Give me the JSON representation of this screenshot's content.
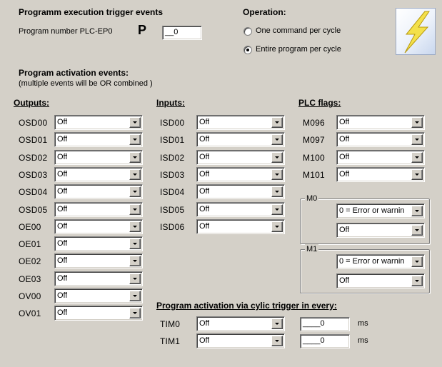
{
  "header": {
    "title": "Programm execution trigger events",
    "program_number_label": "Program number PLC-EP0",
    "p_label": "P",
    "program_number_value": "__0"
  },
  "operation": {
    "title": "Operation:",
    "options": [
      {
        "label": "One command per cycle",
        "selected": false
      },
      {
        "label": "Entire program per cycle",
        "selected": true
      }
    ]
  },
  "logo_icon": "lightning-bolt-icon",
  "activation": {
    "title": "Program activation events:",
    "note": "(multiple events will be OR combined )"
  },
  "outputs": {
    "header": "Outputs:",
    "rows": [
      {
        "label": "OSD00",
        "value": "Off"
      },
      {
        "label": "OSD01",
        "value": "Off"
      },
      {
        "label": "OSD02",
        "value": "Off"
      },
      {
        "label": "OSD03",
        "value": "Off"
      },
      {
        "label": "OSD04",
        "value": "Off"
      },
      {
        "label": "OSD05",
        "value": "Off"
      },
      {
        "label": "OE00",
        "value": "Off"
      },
      {
        "label": "OE01",
        "value": "Off"
      },
      {
        "label": "OE02",
        "value": "Off"
      },
      {
        "label": "OE03",
        "value": "Off"
      },
      {
        "label": "OV00",
        "value": "Off"
      },
      {
        "label": "OV01",
        "value": "Off"
      }
    ]
  },
  "inputs": {
    "header": "Inputs:",
    "rows": [
      {
        "label": "ISD00",
        "value": "Off"
      },
      {
        "label": "ISD01",
        "value": "Off"
      },
      {
        "label": "ISD02",
        "value": "Off"
      },
      {
        "label": "ISD03",
        "value": "Off"
      },
      {
        "label": "ISD04",
        "value": "Off"
      },
      {
        "label": "ISD05",
        "value": "Off"
      },
      {
        "label": "ISD06",
        "value": "Off"
      }
    ]
  },
  "plc_flags": {
    "header": "PLC flags:",
    "rows": [
      {
        "label": "M096",
        "value": "Off"
      },
      {
        "label": "M097",
        "value": "Off"
      },
      {
        "label": "M100",
        "value": "Off"
      },
      {
        "label": "M101",
        "value": "Off"
      }
    ],
    "groups": [
      {
        "caption": "M0",
        "mode": "0 = Error or warnin",
        "value": "Off"
      },
      {
        "caption": "M1",
        "mode": "0 = Error or warnin",
        "value": "Off"
      }
    ]
  },
  "cyclic": {
    "header": "Program activation via cylic trigger in every:",
    "rows": [
      {
        "label": "TIM0",
        "value": "Off",
        "interval": "____0",
        "unit": "ms"
      },
      {
        "label": "TIM1",
        "value": "Off",
        "interval": "____0",
        "unit": "ms"
      }
    ]
  }
}
